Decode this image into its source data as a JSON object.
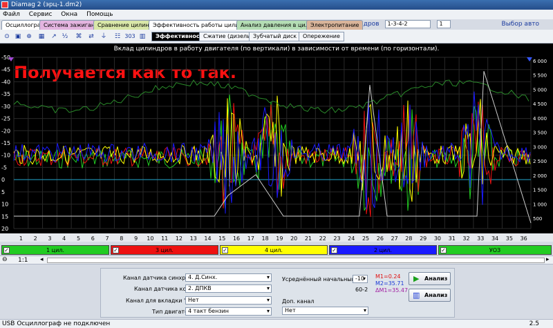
{
  "window": {
    "title": "Diamag 2 (эрц-1.dm2)"
  },
  "menu": [
    "Файл",
    "Сервис",
    "Окна",
    "Помощь"
  ],
  "cylinder_order": {
    "label": "Порядок работы цилиндров",
    "value": "1-3-4-2",
    "spin_value": "1",
    "auto_select": "Выбор авто"
  },
  "tabs": [
    "Осциллограф",
    "Система зажигания",
    "Сравнение цилиндров",
    "Эффективность работы цилиндров",
    "Анализ давления в цилиндре",
    "Электропитание"
  ],
  "subtabs": [
    "Эффективность",
    "Сжатие (дизель)",
    "Зубчатый диск",
    "Опережение"
  ],
  "toolbar_icons": [
    "cursor-icon",
    "zoom-icon",
    "measure-icon",
    "print-icon",
    "chart-icon",
    "ratio-icon",
    "network-icon",
    "sync-icon",
    "filter-icon",
    "db-icon",
    "303-icon",
    "bars-icon"
  ],
  "toolbar_text": {
    "btn303": "303"
  },
  "plot": {
    "title": "Вклад цилиндров в работу двигателя (по вертикали) в зависимости от времени (по горизонтали).",
    "overlay": "Получается как то так.",
    "y_left_ticks": [
      "-50",
      "-45",
      "-40",
      "-35",
      "-30",
      "-25",
      "-20",
      "-15",
      "-10",
      "-5",
      "0",
      "5",
      "10",
      "15",
      "20"
    ],
    "y_right_ticks": [
      "6 000",
      "5 500",
      "5 000",
      "4 500",
      "4 000",
      "3 500",
      "3 000",
      "2 500",
      "2 000",
      "1 500",
      "1 000",
      "500"
    ],
    "x_ticks": [
      "1",
      "2",
      "3",
      "4",
      "5",
      "6",
      "7",
      "8",
      "9",
      "10",
      "11",
      "12",
      "13",
      "14",
      "15",
      "16",
      "17",
      "18",
      "19",
      "20",
      "21",
      "22",
      "23",
      "24",
      "25",
      "26",
      "27",
      "28",
      "29",
      "30",
      "31",
      "32",
      "33",
      "34",
      "35",
      "36"
    ]
  },
  "channels": [
    {
      "name": "1 цил.",
      "color": "#22cc22"
    },
    {
      "name": "3 цил.",
      "color": "#ee1111"
    },
    {
      "name": "4 цил.",
      "color": "#ffff00"
    },
    {
      "name": "2 цил.",
      "color": "#1a1aff"
    },
    {
      "name": "УОЗ",
      "color": "#22cc22"
    }
  ],
  "scroll": {
    "zoom": "1:1"
  },
  "settings": {
    "sync_label": "Канал датчика синхронизации",
    "sync_value": "4. Д.Синх.",
    "crank_label": "Канал датчика коленвала",
    "crank_value": "2. ДПКВ",
    "phase_label": "Канал для вкладки \"Фаза\"",
    "phase_value": "Нет",
    "engine_label": "Тип двигателя",
    "engine_value": "4 такт бензин",
    "uoz_label": "Усреднённый начальный УОЗ",
    "uoz_value": "-10",
    "gear": "60-2",
    "extra_label": "Доп. канал",
    "extra_value": "Нет",
    "m1": "M1=0.24",
    "m2": "M2=35.71",
    "dm": "ΔM1=35.47"
  },
  "buttons": {
    "analyze1": "Анализ",
    "analyze2": "Анализ"
  },
  "status": {
    "left": "USB Осциллограф не подключен",
    "right": "2.5"
  }
}
